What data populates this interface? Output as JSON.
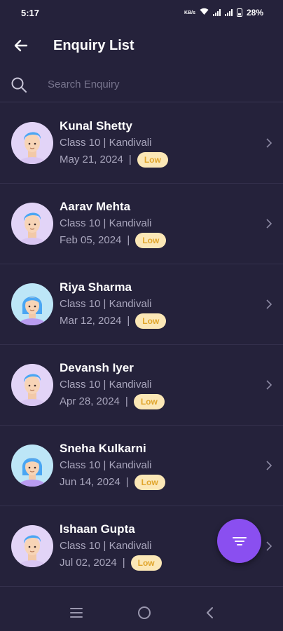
{
  "status": {
    "time": "5:17",
    "battery": "28%"
  },
  "header": {
    "title": "Enquiry List"
  },
  "search": {
    "placeholder": "Search Enquiry"
  },
  "enquiries": [
    {
      "name": "Kunal Shetty",
      "meta": "Class 10 | Kandivali",
      "date": "May 21, 2024",
      "priority": "Low",
      "avatar": "boy-avatar"
    },
    {
      "name": "Aarav Mehta",
      "meta": "Class 10 | Kandivali",
      "date": "Feb 05, 2024",
      "priority": "Low",
      "avatar": "boy-avatar"
    },
    {
      "name": "Riya Sharma",
      "meta": "Class 10 | Kandivali",
      "date": "Mar 12, 2024",
      "priority": "Low",
      "avatar": "girl-avatar"
    },
    {
      "name": "Devansh Iyer",
      "meta": "Class 10 | Kandivali",
      "date": "Apr 28, 2024",
      "priority": "Low",
      "avatar": "boy-avatar"
    },
    {
      "name": "Sneha Kulkarni",
      "meta": "Class 10 | Kandivali",
      "date": "Jun 14, 2024",
      "priority": "Low",
      "avatar": "girl-avatar"
    },
    {
      "name": "Ishaan Gupta",
      "meta": "Class 10 | Kandivali",
      "date": "Jul 02, 2024",
      "priority": "Low",
      "avatar": "boy-avatar"
    }
  ],
  "colors": {
    "background": "#25223b",
    "fab": "#8a4ff0",
    "badge_bg": "#fbe7b6",
    "badge_text": "#e0a52c"
  },
  "icons": {
    "back": "arrow-left-icon",
    "search": "search-icon",
    "chevron": "chevron-right-icon",
    "fab": "filter-icon",
    "nav": [
      "menu-icon",
      "home-circle-icon",
      "back-chevron-icon"
    ]
  }
}
